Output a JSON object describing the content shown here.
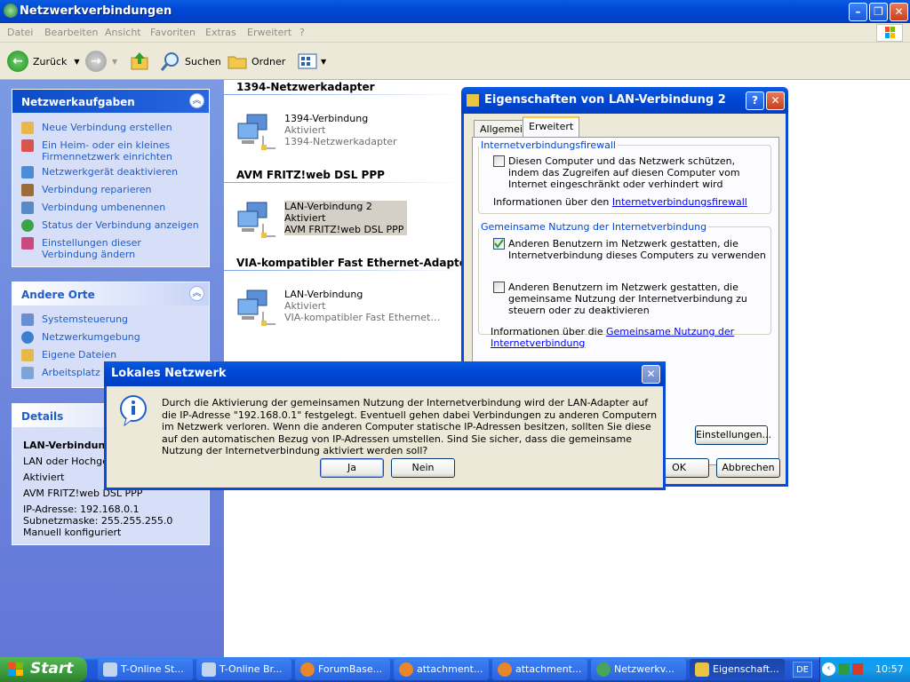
{
  "window": {
    "title": "Netzwerkverbindungen",
    "menu": [
      "Datei",
      "Bearbeiten",
      "Ansicht",
      "Favoriten",
      "Extras",
      "Erweitert",
      "?"
    ],
    "toolbar": {
      "back": "Zurück",
      "search": "Suchen",
      "folders": "Ordner"
    }
  },
  "tasks": {
    "title": "Netzwerkaufgaben",
    "items": [
      {
        "label": "Neue Verbindung erstellen",
        "icon": "new-connection-icon"
      },
      {
        "label": "Ein Heim- oder ein kleines Firmennetzwerk einrichten",
        "icon": "home-network-icon"
      },
      {
        "label": "Netzwerkgerät deaktivieren",
        "icon": "disable-device-icon"
      },
      {
        "label": "Verbindung reparieren",
        "icon": "repair-icon"
      },
      {
        "label": "Verbindung umbenennen",
        "icon": "rename-icon"
      },
      {
        "label": "Status der Verbindung anzeigen",
        "icon": "status-icon"
      },
      {
        "label": "Einstellungen dieser Verbindung ändern",
        "icon": "settings-icon"
      }
    ]
  },
  "places": {
    "title": "Andere Orte",
    "items": [
      {
        "label": "Systemsteuerung",
        "icon": "control-panel-icon"
      },
      {
        "label": "Netzwerkumgebung",
        "icon": "network-places-icon"
      },
      {
        "label": "Eigene Dateien",
        "icon": "my-documents-icon"
      },
      {
        "label": "Arbeitsplatz",
        "icon": "my-computer-icon"
      }
    ]
  },
  "details": {
    "title": "Details",
    "name": "LAN-Verbindung",
    "type": "LAN oder Hochgesc",
    "status": "Aktiviert",
    "device": "AVM FRITZ!web DSL PPP",
    "ip": "IP-Adresse: 192.168.0.1",
    "mask": "Subnetzmaske: 255.255.255.0",
    "config": "Manuell konfiguriert"
  },
  "groups": [
    {
      "title": "1394-Netzwerkadapter",
      "conn": {
        "name": "1394-Verbindung",
        "status": "Aktiviert",
        "device": "1394-Netzwerkadapter"
      }
    },
    {
      "title": "AVM FRITZ!web DSL PPP",
      "conn": {
        "name": "LAN-Verbindung 2",
        "status": "Aktiviert",
        "device": "AVM FRITZ!web DSL PPP"
      }
    },
    {
      "title": "VIA-kompatibler Fast Ethernet-Adapter",
      "conn": {
        "name": "LAN-Verbindung",
        "status": "Aktiviert",
        "device": "VIA-kompatibler Fast Ethernet…"
      }
    }
  ],
  "props": {
    "title": "Eigenschaften von LAN-Verbindung 2",
    "tab_general": "Allgemein",
    "tab_advanced": "Erweitert",
    "fw_legend": "Internetverbindungsfirewall",
    "fw_check": "Diesen Computer und das Netzwerk schützen, indem das Zugreifen auf diesen Computer vom Internet eingeschränkt oder verhindert wird",
    "fw_info": "Informationen über den ",
    "fw_link": "Internetverbindungsfirewall",
    "ics_legend": "Gemeinsame Nutzung der Internetverbindung",
    "ics_check1": "Anderen Benutzern im Netzwerk gestatten, die Internetverbindung dieses Computers zu verwenden",
    "ics_check2": "Anderen Benutzern im Netzwerk gestatten, die gemeinsame Nutzung der Internetverbindung zu steuern oder zu deaktivieren",
    "ics_info": "Informationen über die ",
    "ics_link": "Gemeinsame Nutzung der Internetverbindung",
    "settings": "Einstellungen...",
    "ok": "OK",
    "cancel": "Abbrechen"
  },
  "msgbox": {
    "title": "Lokales Netzwerk",
    "text": "Durch die Aktivierung der gemeinsamen Nutzung der Internetverbindung wird der LAN-Adapter auf die IP-Adresse \"192.168.0.1\" festgelegt. Eventuell gehen dabei Verbindungen zu anderen Computern im Netzwerk verloren. Wenn die anderen Computer statische IP-Adressen besitzen, sollten Sie diese auf den automatischen Bezug von IP-Adressen umstellen. Sind Sie sicher, dass die gemeinsame Nutzung der Internetverbindung aktiviert werden soll?",
    "yes": "Ja",
    "no": "Nein"
  },
  "taskbar": {
    "start": "Start",
    "tasks": [
      {
        "label": "T-Online St...",
        "active": false
      },
      {
        "label": "T-Online Br...",
        "active": false
      },
      {
        "label": "ForumBase...",
        "active": false
      },
      {
        "label": "attachment...",
        "active": false
      },
      {
        "label": "attachment...",
        "active": false
      },
      {
        "label": "Netzwerkv...",
        "active": false
      },
      {
        "label": "Eigenschaft...",
        "active": true
      }
    ],
    "lang": "DE",
    "clock": "10:57"
  }
}
